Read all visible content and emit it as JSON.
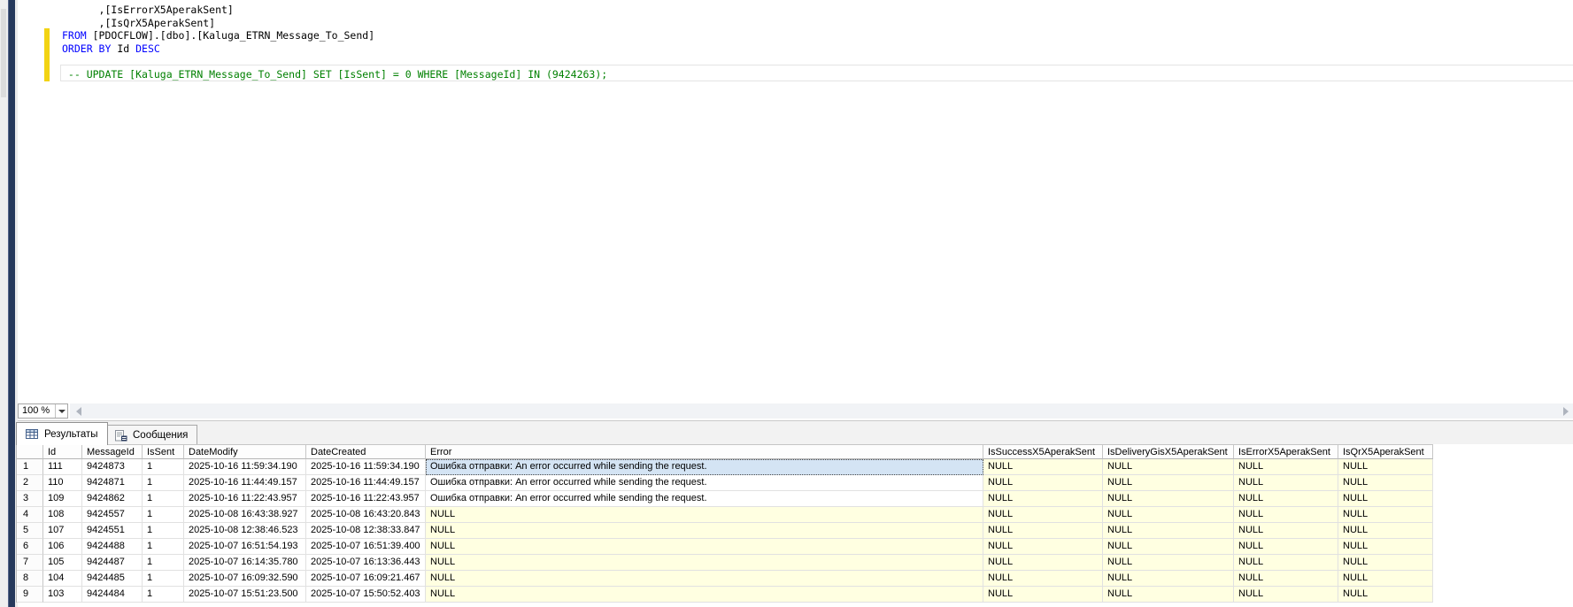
{
  "colors": {
    "keyword": "#0000ff",
    "comment": "#008000",
    "identifier": "#000000",
    "null_cell_bg": "#ffffe1",
    "selected_cell_bg": "#d4e4f4",
    "change_bar_yellow": "#f2d313",
    "navy_rail": "#26395c"
  },
  "editor": {
    "zoom_value": "100 %",
    "lines": [
      {
        "segments": [
          {
            "t": "      ,[IsErrorX5AperakSent]",
            "c": "identifier"
          }
        ]
      },
      {
        "segments": [
          {
            "t": "      ,[IsQrX5AperakSent]",
            "c": "identifier"
          }
        ]
      },
      {
        "segments": [
          {
            "t": "FROM",
            "c": "keyword"
          },
          {
            "t": " [PDOCFLOW].[dbo].[Kaluga_ETRN_Message_To_Send]",
            "c": "identifier"
          }
        ]
      },
      {
        "segments": [
          {
            "t": "ORDER BY",
            "c": "keyword"
          },
          {
            "t": " Id ",
            "c": "identifier"
          },
          {
            "t": "DESC",
            "c": "keyword"
          }
        ]
      },
      {
        "segments": []
      },
      {
        "segments": [
          {
            "t": " -- UPDATE [Kaluga_ETRN_Message_To_Send] SET [IsSent] = 0 WHERE [MessageId] IN (9424263);",
            "c": "comment"
          }
        ],
        "current_line": true
      }
    ]
  },
  "results_panel": {
    "tabs": [
      {
        "label": "Результаты",
        "icon": "results-grid-icon",
        "selected": true
      },
      {
        "label": "Сообщения",
        "icon": "messages-icon",
        "selected": false
      }
    ],
    "grid": {
      "columns": [
        "",
        "Id",
        "MessageId",
        "IsSent",
        "DateModify",
        "DateCreated",
        "Error",
        "IsSuccessX5AperakSent",
        "IsDeliveryGisX5AperakSent",
        "IsErrorX5AperakSent",
        "IsQrX5AperakSent"
      ],
      "error_message": "Ошибка отправки: An error occurred while sending the request.",
      "selected_cell": {
        "row": 0,
        "col": 6
      },
      "rows": [
        [
          "1",
          "111",
          "9424873",
          "1",
          "2025-10-16 11:59:34.190",
          "2025-10-16 11:59:34.190",
          "Ошибка отправки: An error occurred while sending the request.",
          "NULL",
          "NULL",
          "NULL",
          "NULL"
        ],
        [
          "2",
          "110",
          "9424871",
          "1",
          "2025-10-16 11:44:49.157",
          "2025-10-16 11:44:49.157",
          "Ошибка отправки: An error occurred while sending the request.",
          "NULL",
          "NULL",
          "NULL",
          "NULL"
        ],
        [
          "3",
          "109",
          "9424862",
          "1",
          "2025-10-16 11:22:43.957",
          "2025-10-16 11:22:43.957",
          "Ошибка отправки: An error occurred while sending the request.",
          "NULL",
          "NULL",
          "NULL",
          "NULL"
        ],
        [
          "4",
          "108",
          "9424557",
          "1",
          "2025-10-08 16:43:38.927",
          "2025-10-08 16:43:20.843",
          "NULL",
          "NULL",
          "NULL",
          "NULL",
          "NULL"
        ],
        [
          "5",
          "107",
          "9424551",
          "1",
          "2025-10-08 12:38:46.523",
          "2025-10-08 12:38:33.847",
          "NULL",
          "NULL",
          "NULL",
          "NULL",
          "NULL"
        ],
        [
          "6",
          "106",
          "9424488",
          "1",
          "2025-10-07 16:51:54.193",
          "2025-10-07 16:51:39.400",
          "NULL",
          "NULL",
          "NULL",
          "NULL",
          "NULL"
        ],
        [
          "7",
          "105",
          "9424487",
          "1",
          "2025-10-07 16:14:35.780",
          "2025-10-07 16:13:36.443",
          "NULL",
          "NULL",
          "NULL",
          "NULL",
          "NULL"
        ],
        [
          "8",
          "104",
          "9424485",
          "1",
          "2025-10-07 16:09:32.590",
          "2025-10-07 16:09:21.467",
          "NULL",
          "NULL",
          "NULL",
          "NULL",
          "NULL"
        ],
        [
          "9",
          "103",
          "9424484",
          "1",
          "2025-10-07 15:51:23.500",
          "2025-10-07 15:50:52.403",
          "NULL",
          "NULL",
          "NULL",
          "NULL",
          "NULL"
        ]
      ]
    }
  }
}
